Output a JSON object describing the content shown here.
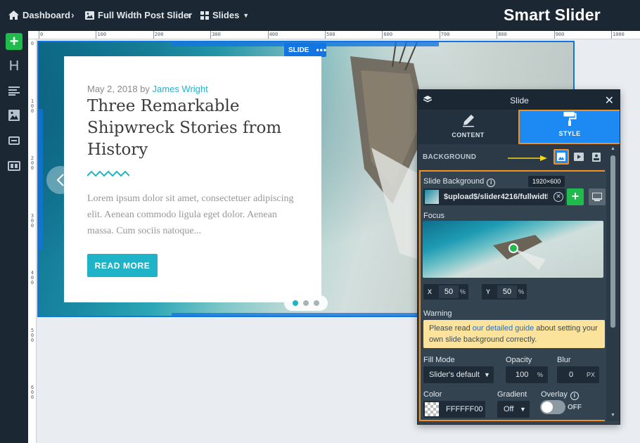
{
  "breadcrumb": {
    "dashboard": "Dashboard",
    "slider": "Full Width Post Slider",
    "slides": "Slides"
  },
  "logo": "Smart Slider",
  "ruler": {
    "top_labels": [
      "0",
      "100",
      "200",
      "300",
      "400",
      "500",
      "600",
      "700",
      "800",
      "900",
      "1000"
    ],
    "left_labels": [
      "0",
      "100",
      "200",
      "300",
      "400",
      "500",
      "600"
    ]
  },
  "slide_tag": "SLIDE",
  "post": {
    "date": "May 2, 2018",
    "by": "by",
    "author": "James Wright",
    "title": "Three Remarkable Shipwreck Stories from History",
    "excerpt": "Lorem ipsum dolor sit amet, consectetuer adipiscing elit. Aenean commodo ligula eget dolor. Aenean massa. Cum sociis natoque...",
    "button": "READ MORE"
  },
  "panel": {
    "title": "Slide",
    "tabs": {
      "content": "CONTENT",
      "style": "STYLE"
    },
    "section": "BACKGROUND",
    "slide_background_label": "Slide Background",
    "tooltip": "1920×600",
    "bg_path": "$upload$/slider4216/fullwidthb",
    "focus_label": "Focus",
    "x_label": "X",
    "x_value": "50",
    "x_unit": "%",
    "y_label": "Y",
    "y_value": "50",
    "y_unit": "%",
    "warning_label": "Warning",
    "warning_pre": "Please read ",
    "warning_link": "our detailed guide",
    "warning_post": " about setting your own slide background correctly.",
    "fill_mode_label": "Fill Mode",
    "fill_mode_value": "Slider's default",
    "opacity_label": "Opacity",
    "opacity_value": "100",
    "opacity_unit": "%",
    "blur_label": "Blur",
    "blur_value": "0",
    "blur_unit": "PX",
    "color_label": "Color",
    "color_value": "FFFFFF00",
    "gradient_label": "Gradient",
    "gradient_value": "Off",
    "overlay_label": "Overlay",
    "overlay_value": "OFF"
  },
  "colors": {
    "accent": "#1c8af2",
    "highlight": "#f29122",
    "add_green": "#1fbb4c",
    "cta": "#1fb3c8"
  }
}
